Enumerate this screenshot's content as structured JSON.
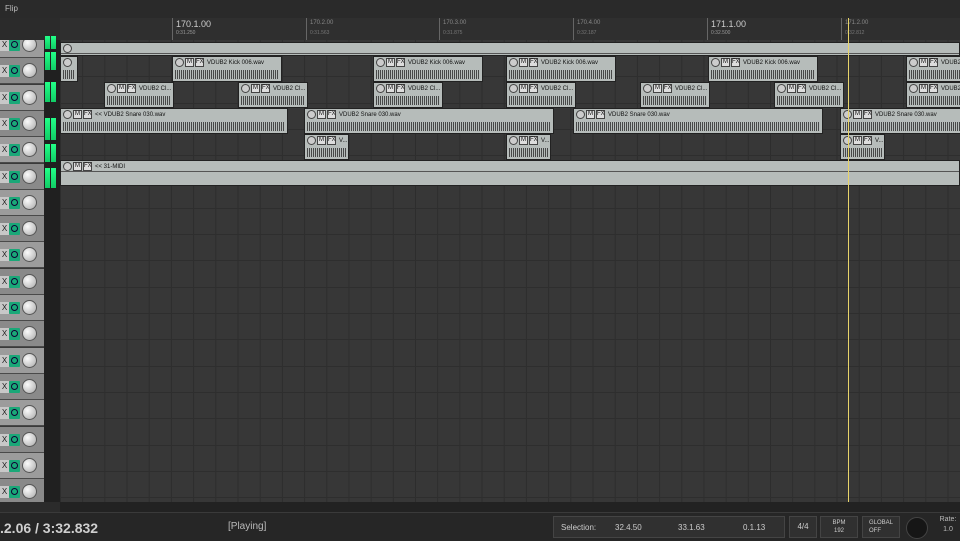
{
  "window": {
    "title": "Flip"
  },
  "ruler": [
    {
      "bar": "170.1.00",
      "time": "0:31.250",
      "big": true
    },
    {
      "bar": "170.2.00",
      "time": "0:31.563",
      "big": false
    },
    {
      "bar": "170.3.00",
      "time": "0:31.875",
      "big": false
    },
    {
      "bar": "170.4.00",
      "time": "0:32.187",
      "big": false
    },
    {
      "bar": "171.1.00",
      "time": "0:32.500",
      "big": true
    },
    {
      "bar": "171.2.00",
      "time": "0:32.812",
      "big": false
    }
  ],
  "tracks": {
    "count": 18,
    "x_label": "X"
  },
  "items": {
    "kick": "VDUB2 Kick 006.wav",
    "clap": "VDUB2 Cl...",
    "snare": "<< VDUB2 Snare 030.wav",
    "snare2": "VDUB2 Snare 030.wav",
    "v": "V...",
    "midi": "<< 31-MIDI",
    "mute_btn": "M",
    "fx_btn": "FX"
  },
  "transport": {
    "time": ".2.06 / 3:32.832",
    "state": "[Playing]",
    "selection_label": "Selection:",
    "sel_start": "32.4.50",
    "sel_end": "33.1.63",
    "sel_length": "0.1.13",
    "time_sig": "4/4",
    "bpm_label": "BPM",
    "bpm_value": "192",
    "global_label": "GLOBAL",
    "global_state": "OFF",
    "rate_label": "Rate:",
    "rate_value": "1.0"
  }
}
